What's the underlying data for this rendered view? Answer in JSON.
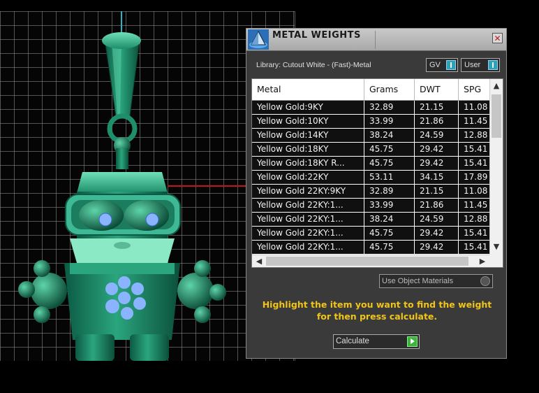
{
  "dialog": {
    "title": "METAL WEIGHTS",
    "close_glyph": "✕",
    "library_label": "Library: Cutout White - (Fast)-Metal",
    "toggle_gv": "GV",
    "toggle_user": "User",
    "columns": [
      "Metal",
      "Grams",
      "DWT",
      "SPG"
    ],
    "rows": [
      [
        "Yellow Gold:9KY",
        "32.89",
        "21.15",
        "11.08"
      ],
      [
        "Yellow Gold:10KY",
        "33.99",
        "21.86",
        "11.45"
      ],
      [
        "Yellow Gold:14KY",
        "38.24",
        "24.59",
        "12.88"
      ],
      [
        "Yellow Gold:18KY",
        "45.75",
        "29.42",
        "15.41"
      ],
      [
        "Yellow Gold:18KY R...",
        "45.75",
        "29.42",
        "15.41"
      ],
      [
        "Yellow Gold:22KY",
        "53.11",
        "34.15",
        "17.89"
      ],
      [
        "Yellow Gold 22KY:9KY",
        "32.89",
        "21.15",
        "11.08"
      ],
      [
        "Yellow Gold 22KY:1...",
        "33.99",
        "21.86",
        "11.45"
      ],
      [
        "Yellow Gold 22KY:1...",
        "38.24",
        "24.59",
        "12.88"
      ],
      [
        "Yellow Gold 22KY:1...",
        "45.75",
        "29.42",
        "15.41"
      ],
      [
        "Yellow Gold 22KY:1...",
        "45.75",
        "29.42",
        "15.41"
      ]
    ],
    "use_object_materials": "Use Object Materials",
    "instructions_line1": "Highlight the item you want to find the weight",
    "instructions_line2": "for then press calculate.",
    "calculate_label": "Calculate"
  },
  "icons": {
    "logo": "rhino-pyramid-icon",
    "vscroll_up": "▲",
    "vscroll_down": "▼",
    "hscroll_left": "◀",
    "hscroll_right": "▶"
  },
  "colors": {
    "model": "#1e8a68",
    "model_light": "#4ec9a0",
    "gem": "#8ab4ff",
    "instructions": "#f0c419",
    "toggle_knob": "#29a3b5",
    "calculate_play": "#3fb23f"
  }
}
